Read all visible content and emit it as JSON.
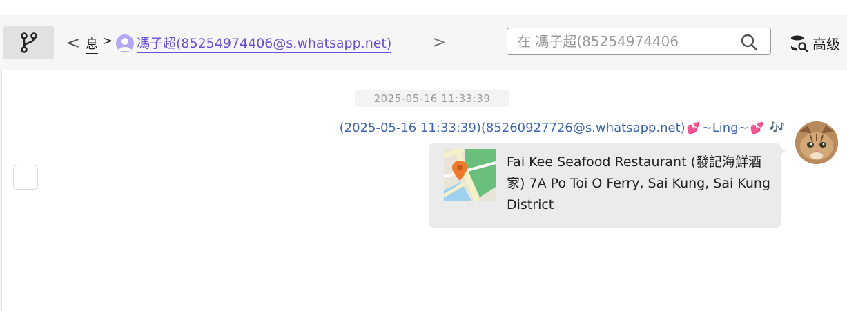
{
  "toolbar": {
    "back_arrow": "<",
    "forward_arrow": ">",
    "breadcrumb_short": "息",
    "breadcrumb_sep": ">",
    "breadcrumb_contact": "馮子超(85254974406@s.whatsapp.net)",
    "search_placeholder": "在 馮子超(85254974406",
    "advanced_label": "高级"
  },
  "chat": {
    "timestamp": "2025-05-16 11:33:39",
    "sender_prefix": "(2025-05-16 11:33:39)(85260927726@s.whatsapp.net)",
    "sender_name": "~Ling~",
    "heart_left": "💕",
    "heart_right": "💕",
    "notes_emoji": "🎶",
    "location_text": "Fai Kee Seafood Restaurant (發記海鮮酒家) 7A Po Toi O Ferry, Sai Kung, Sai Kung District"
  },
  "icons": {
    "branch": "branch-icon",
    "search": "search-icon",
    "advanced": "database-search-icon",
    "map_pin": "map-pin-icon"
  },
  "colors": {
    "link": "#6a4fd8",
    "sender": "#3d66b0",
    "bubble": "#ebebeb",
    "pin": "#ee7a2c",
    "map_green": "#6bbf7d"
  }
}
